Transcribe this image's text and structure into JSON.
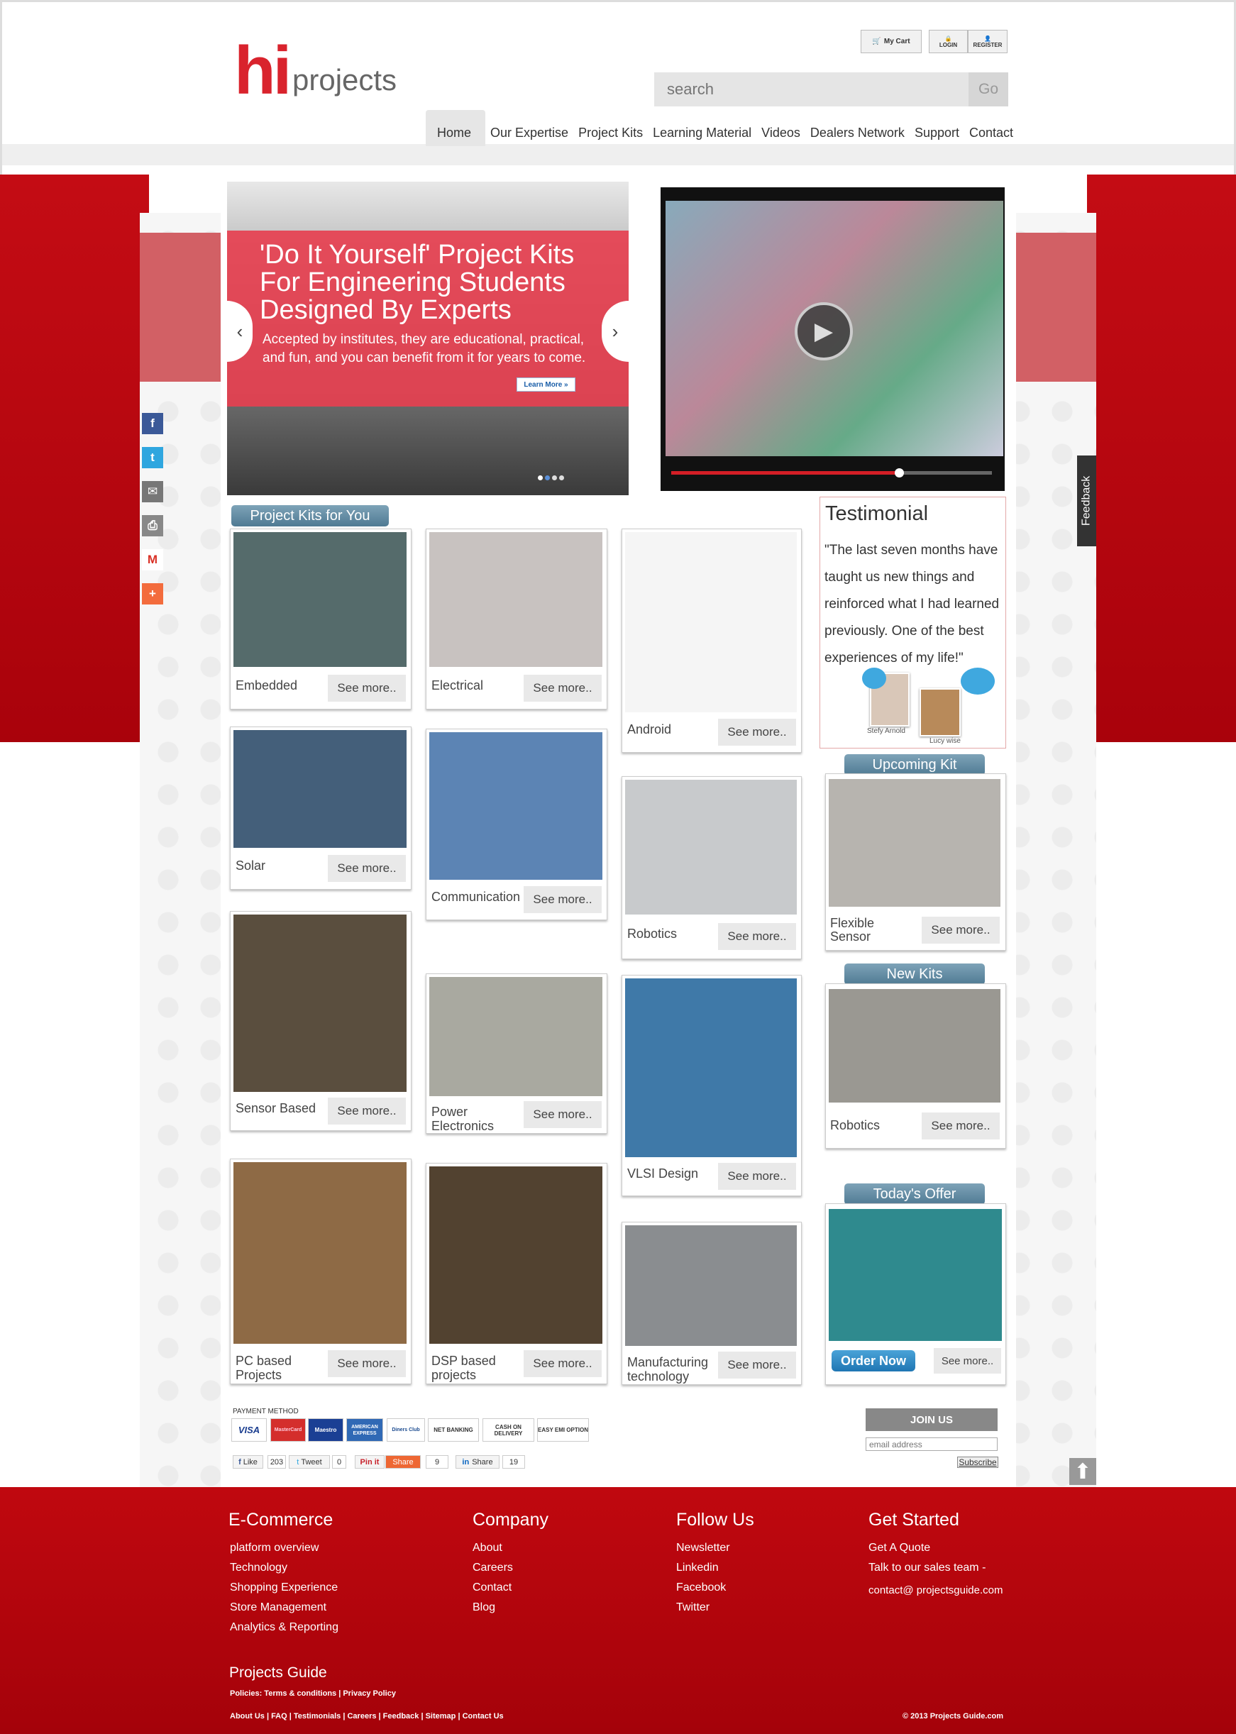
{
  "header": {
    "logo_hi": "hi",
    "logo_projects": "projects",
    "my_cart": "My Cart",
    "login": "LOGIN",
    "register": "REGISTER",
    "search_placeholder": "search",
    "search_go": "Go",
    "nav": [
      "Home",
      "Our Expertise",
      "Project Kits",
      "Learning Material",
      "Videos",
      "Dealers Network",
      "Support",
      "Contact"
    ]
  },
  "slider": {
    "title": "'Do It Yourself' Project Kits For Engineering Students Designed By Experts",
    "subtitle": "Accepted by institutes, they are educational, practical, and fun, and you can benefit from it for years to come.",
    "learn_more": "Learn More »",
    "prev": "‹",
    "next": "›"
  },
  "video": {
    "play": "▶",
    "progress": 0.71
  },
  "social": [
    {
      "icon": "facebook-icon",
      "glyph": "f",
      "color": "#3b5998"
    },
    {
      "icon": "twitter-icon",
      "glyph": "t",
      "color": "#2fa6df"
    },
    {
      "icon": "email-icon",
      "glyph": "✉",
      "color": "#777"
    },
    {
      "icon": "print-icon",
      "glyph": "⎙",
      "color": "#888"
    },
    {
      "icon": "gmail-icon",
      "glyph": "M",
      "color": "#fff"
    },
    {
      "icon": "add-icon",
      "glyph": "+",
      "color": "#f36c3d"
    }
  ],
  "sections": {
    "project_kits": "Project Kits for You",
    "upcoming_kit": "Upcoming Kit",
    "new_kits": "New Kits",
    "todays_offer": "Today's Offer"
  },
  "see_more": "See more..",
  "kits": [
    {
      "label": "Embedded",
      "color": "#556b6b"
    },
    {
      "label": "Electrical",
      "color": "#c8c2c0"
    },
    {
      "label": "Android",
      "color": "#f5f5f5"
    },
    {
      "label": "Solar",
      "color": "#445f7a"
    },
    {
      "label": "Communication",
      "color": "#5c84b4"
    },
    {
      "label": "Robotics",
      "color": "#c8cacc"
    },
    {
      "label": "Sensor Based",
      "color": "#5a4e3e"
    },
    {
      "label": "Power Electronics",
      "color": "#a9a9a0"
    },
    {
      "label": "VLSI Design",
      "color": "#3f79a8"
    },
    {
      "label": "PC based Projects",
      "color": "#8e6a45"
    },
    {
      "label": "DSP based projects",
      "color": "#524230"
    },
    {
      "label": "Manufacturing technology",
      "color": "#8a8d90"
    }
  ],
  "testimonial": {
    "title": "Testimonial",
    "quote": "\"The last seven months have taught us new things and reinforced what I had learned previously. One of the best experiences of my life!\"",
    "name1": "Stefy Arnold",
    "name2": "Lucy wise"
  },
  "upcoming": {
    "label": "Flexible Sensor",
    "color": "#b7b4af"
  },
  "new_kit": {
    "label": "Robotics",
    "color": "#9a9892"
  },
  "offer": {
    "order_now": "Order Now",
    "color": "#2f8a8e"
  },
  "payment": {
    "label": "PAYMENT METHOD",
    "methods": [
      "VISA",
      "MasterCard",
      "Maestro",
      "AMERICAN EXPRESS",
      "Diners Club",
      "NET BANKING",
      "CASH ON DELIVERY",
      "EASY EMI OPTION"
    ]
  },
  "share_bar": {
    "like": "Like",
    "like_count": "203",
    "tweet": "Tweet",
    "tweet_count": "0",
    "pinit": "Pin it",
    "share": "Share",
    "share_count": "9",
    "in_share": "Share",
    "in_count": "19"
  },
  "newsletter": {
    "join": "JOIN US",
    "email_placeholder": "email address",
    "subscribe": "Subscribe"
  },
  "feedback": "Feedback",
  "footer": {
    "ecommerce": {
      "title": "E-Commerce",
      "links": [
        "platform overview",
        "Technology",
        "Shopping Experience",
        "Store Management",
        "Analytics & Reporting"
      ]
    },
    "company": {
      "title": "Company",
      "links": [
        "About",
        "Careers",
        "Contact",
        "Blog"
      ]
    },
    "follow": {
      "title": "Follow Us",
      "links": [
        "Newsletter",
        "Linkedin",
        "Facebook",
        "Twitter"
      ]
    },
    "started": {
      "title": "Get Started",
      "links": [
        "Get A Quote",
        "Talk to our sales team -",
        "contact@ projectsguide.com"
      ]
    },
    "projects_guide": "Projects Guide",
    "policies": "Policies: Terms & conditions | Privacy Policy",
    "bottom_links": "About Us | FAQ | Testimonials | Careers | Feedback | Sitemap | Contact Us",
    "copyright": "© 2013 Projects Guide.com"
  }
}
